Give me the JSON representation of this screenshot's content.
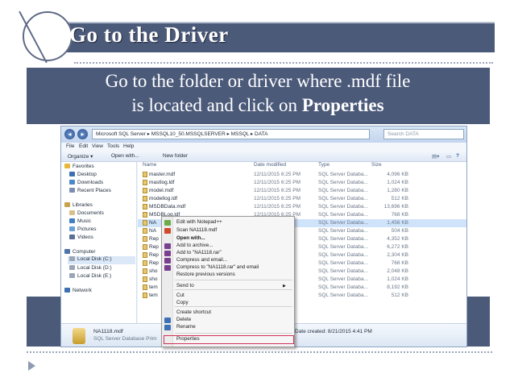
{
  "slide": {
    "title": "Go to the Driver",
    "subtitle_line1": "Go to the folder or driver where .mdf file",
    "subtitle_line2_prefix": "is located and click on ",
    "subtitle_line2_bold": "Properties"
  },
  "explorer": {
    "breadcrumb": "Microsoft SQL Server ▸ MSSQL10_50.MSSQLSERVER ▸ MSSQL ▸ DATA",
    "search_placeholder": "Search DATA",
    "menu": [
      "File",
      "Edit",
      "View",
      "Tools",
      "Help"
    ],
    "toolbar": {
      "organize": "Organize ▾",
      "open_with": "Open with...",
      "new_folder": "New folder"
    },
    "nav_items": [
      {
        "label": "Favorites",
        "icon": "star-icon"
      },
      {
        "label": "Desktop",
        "icon": "desktop-icon"
      },
      {
        "label": "Downloads",
        "icon": "downloads-icon"
      },
      {
        "label": "Recent Places",
        "icon": "recent-places-icon"
      },
      {
        "label": "Libraries",
        "icon": "libraries-icon"
      },
      {
        "label": "Documents",
        "icon": "documents-icon"
      },
      {
        "label": "Music",
        "icon": "music-icon"
      },
      {
        "label": "Pictures",
        "icon": "pictures-icon"
      },
      {
        "label": "Videos",
        "icon": "videos-icon"
      },
      {
        "label": "Computer",
        "icon": "computer-icon"
      },
      {
        "label": "Local Disk (C:)",
        "icon": "drive-icon"
      },
      {
        "label": "Local Disk (D:)",
        "icon": "drive-icon"
      },
      {
        "label": "Local Disk (E:)",
        "icon": "drive-icon"
      },
      {
        "label": "Network",
        "icon": "network-icon"
      }
    ],
    "columns": [
      "Name",
      "Date modified",
      "Type",
      "Size"
    ],
    "files": [
      {
        "name": "master.mdf",
        "date": "12/11/2015 6:25 PM",
        "type": "SQL Server Databa...",
        "size": "4,096 KB"
      },
      {
        "name": "mastlog.ldf",
        "date": "12/11/2015 6:25 PM",
        "type": "SQL Server Databa...",
        "size": "1,024 KB"
      },
      {
        "name": "model.mdf",
        "date": "12/11/2015 6:25 PM",
        "type": "SQL Server Databa...",
        "size": "1,280 KB"
      },
      {
        "name": "modellog.ldf",
        "date": "12/11/2015 6:25 PM",
        "type": "SQL Server Databa...",
        "size": "512 KB"
      },
      {
        "name": "MSDBData.mdf",
        "date": "12/11/2015 6:25 PM",
        "type": "SQL Server Databa...",
        "size": "13,696 KB"
      },
      {
        "name": "MSDBLog.ldf",
        "date": "12/11/2015 6:25 PM",
        "type": "SQL Server Databa...",
        "size": "768 KB"
      },
      {
        "name": "NA",
        "date": "25 PM",
        "type": "SQL Server Databa...",
        "size": "1,456 KB"
      },
      {
        "name": "NA",
        "date": "25 PM",
        "type": "SQL Server Databa...",
        "size": "504 KB"
      },
      {
        "name": "Rep",
        "date": "25 PM",
        "type": "SQL Server Databa...",
        "size": "4,352 KB"
      },
      {
        "name": "Rep",
        "date": "25 PM",
        "type": "SQL Server Databa...",
        "size": "6,272 KB"
      },
      {
        "name": "Rep",
        "date": "25 PM",
        "type": "SQL Server Databa...",
        "size": "2,304 KB"
      },
      {
        "name": "Rep",
        "date": "25 PM",
        "type": "SQL Server Databa...",
        "size": "768 KB"
      },
      {
        "name": "sho",
        "date": "25 PM",
        "type": "SQL Server Databa...",
        "size": "2,048 KB"
      },
      {
        "name": "sho",
        "date": "25 PM",
        "type": "SQL Server Databa...",
        "size": "1,024 KB"
      },
      {
        "name": "tem",
        "date": "34 AM",
        "type": "SQL Server Databa...",
        "size": "8,192 KB"
      },
      {
        "name": "tem",
        "date": "34 AM",
        "type": "SQL Server Databa...",
        "size": "512 KB"
      }
    ],
    "status": {
      "file_name": "NA1118.mdf",
      "file_type": "SQL Server Database Prim",
      "date_created": "Date created: 8/21/2015 4:41 PM"
    },
    "context_menu": [
      {
        "label": "Edit with Notepad++",
        "icon": "notepad-icon"
      },
      {
        "label": "Scan NA1118.mdf",
        "icon": "scan-icon"
      },
      {
        "label": "Open with...",
        "icon": ""
      },
      {
        "label": "Add to archive...",
        "icon": "archive-icon"
      },
      {
        "label": "Add to \"NA1118.rar\"",
        "icon": "archive-icon"
      },
      {
        "label": "Compress and email...",
        "icon": "archive-icon"
      },
      {
        "label": "Compress to \"NA1118.rar\" and email",
        "icon": "archive-icon"
      },
      {
        "label": "Restore previous versions",
        "icon": ""
      },
      {
        "label": "Send to",
        "icon": ""
      },
      {
        "label": "Cut",
        "icon": ""
      },
      {
        "label": "Copy",
        "icon": ""
      },
      {
        "label": "Create shortcut",
        "icon": ""
      },
      {
        "label": "Delete",
        "icon": "delete-icon"
      },
      {
        "label": "Rename",
        "icon": "rename-icon"
      },
      {
        "label": "Properties",
        "icon": ""
      }
    ],
    "colors": {
      "slide_accent": "#4c5a7a",
      "highlight_border": "#d0325a",
      "selection": "#cfe3fb"
    }
  }
}
